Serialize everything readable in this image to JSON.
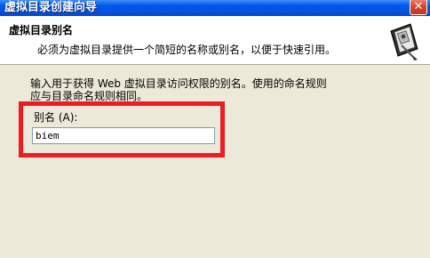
{
  "window": {
    "title": "虚拟目录创建向导",
    "close_glyph": "✕"
  },
  "header": {
    "title": "虚拟目录别名",
    "subtitle": "必须为虚拟目录提供一个简短的名称或别名，以便于快速引用。",
    "icon": "wizard-book-icon"
  },
  "body": {
    "description": "输入用于获得 Web 虚拟目录访问权限的别名。使用的命名规则应与目录命名规则相同。",
    "alias_label": "别名 (A):",
    "alias_value": "biem"
  },
  "colors": {
    "titlebar": "#0054e3",
    "dialog_bg": "#ece9d8",
    "highlight": "#ed1c24",
    "input_border": "#7f9db9"
  }
}
